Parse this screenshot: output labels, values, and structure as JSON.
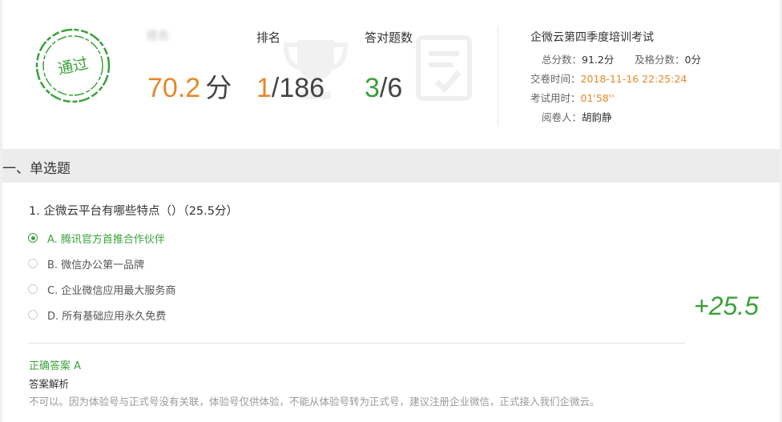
{
  "result": {
    "stamp_text": "通过",
    "user_name": "姓名",
    "score_value": "70.2",
    "score_unit": "分",
    "rank_label": "排名",
    "rank_value": "1",
    "rank_total": "/186",
    "correct_label": "答对题数",
    "correct_value": "3",
    "correct_total": "/6"
  },
  "exam": {
    "title": "企微云第四季度培训考试",
    "total_label": "总分数：",
    "total_value": "91.2分",
    "pass_label": "及格分数：",
    "pass_value": "0分",
    "submit_label": "交卷时间：",
    "submit_value": "2018-11-16 22:25:24",
    "duration_label": "考试用时：",
    "duration_value": "01'58''",
    "reviewer_label": "阅卷人：",
    "reviewer_value": "胡韵静"
  },
  "section": {
    "title": "一、单选题"
  },
  "question": {
    "text": "1. 企微云平台有哪些特点（）（25.5分）",
    "options": [
      {
        "label": "A. 腾讯官方首推合作伙伴",
        "selected": true
      },
      {
        "label": "B. 微信办公第一品牌",
        "selected": false
      },
      {
        "label": "C. 企业微信应用最大服务商",
        "selected": false
      },
      {
        "label": "D. 所有基础应用永久免费",
        "selected": false
      }
    ],
    "score_gain": "+25.5",
    "correct_answer": "正确答案 A",
    "analysis_label": "答案解析",
    "analysis_text": "不可以。因为体验号与正式号没有关联，体验号仅供体验，不能从体验号转为正式号，建议注册企业微信，正式接入我们企微云。"
  },
  "colors": {
    "accent_green": "#3aa13a",
    "accent_orange": "#e6882a"
  },
  "icons": [
    "pass-stamp-icon",
    "trophy-icon",
    "paper-check-icon"
  ]
}
